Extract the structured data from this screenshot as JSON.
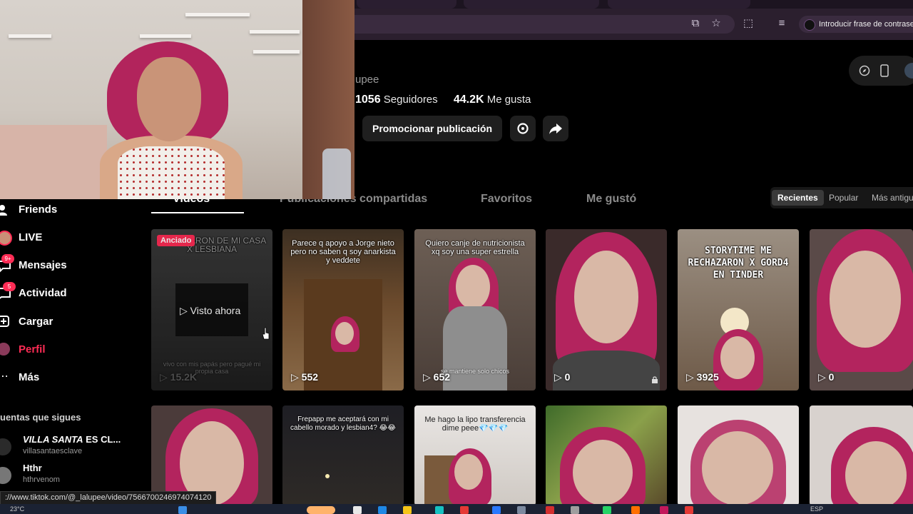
{
  "browser": {
    "toolbar_icons": [
      "install-icon",
      "star-icon",
      "extensions-icon",
      "media-icon"
    ],
    "password_chip": "Introducir frase de contrase"
  },
  "profile": {
    "handle": "upee",
    "followers_count": "1056",
    "followers_label": "Seguidores",
    "likes_count": "44.2K",
    "likes_label": "Me gusta",
    "promote_label": "Promocionar publicación"
  },
  "tabs": {
    "videos": "Videos",
    "shared": "Publicaciones compartidas",
    "favorites": "Favoritos",
    "liked": "Me gustó"
  },
  "sort": {
    "recent": "Recientes",
    "popular": "Popular",
    "oldest": "Más antigu"
  },
  "sidebar": {
    "items": [
      {
        "label": "Friends",
        "icon": "friends-icon",
        "badge": ""
      },
      {
        "label": "LIVE",
        "icon": "live-icon",
        "badge": ""
      },
      {
        "label": "Mensajes",
        "icon": "messages-icon",
        "badge": "9+"
      },
      {
        "label": "Actividad",
        "icon": "activity-icon",
        "badge": "5"
      },
      {
        "label": "Cargar",
        "icon": "upload-icon",
        "badge": ""
      },
      {
        "label": "Perfil",
        "icon": "profile-icon",
        "badge": ""
      },
      {
        "label": "Más",
        "icon": "more-icon",
        "badge": ""
      }
    ],
    "following_title": "uentas que sigues",
    "following": [
      {
        "name_a": "VILLA SANTA",
        "name_b": "ES CL...",
        "username": "villasantaesclave"
      },
      {
        "name": "Hthr",
        "username": "hthrvenom"
      }
    ]
  },
  "videos": {
    "row1": [
      {
        "caption": "ME BOTARON DE MI CASA X LESBIANA",
        "pinned_label": "Anciado",
        "watched_label": "Visto ahora",
        "sub": "vivo con mis papás pero pagué mi propia casa",
        "views": "15.2K"
      },
      {
        "caption": "Parece q apoyo a Jorge nieto pero no saben q soy anarkista y veddete",
        "views": "552"
      },
      {
        "caption": "Quiero canje de nutricionista xq soy una super estrella",
        "sub": "se mantiene solo chicos",
        "views": "652"
      },
      {
        "caption": "",
        "views": "0"
      },
      {
        "caption": "STORYTIME ME RECHAZARON X GORD4 EN TINDER",
        "views": "3925"
      },
      {
        "caption": "",
        "views": "0"
      }
    ],
    "row2": [
      {
        "caption": ""
      },
      {
        "caption": "Frepapp me aceptará con mi cabello morado y lesbian4? 😂😂"
      },
      {
        "caption": "Me hago la lipo transferencia dime peee💎💎💎"
      },
      {
        "caption": ""
      },
      {
        "caption": ""
      },
      {
        "caption": ""
      }
    ]
  },
  "status_url": "://www.tiktok.com/@_lalupee/video/7566700246974074120",
  "taskbar": {
    "temperature": "23°C",
    "language": "ESP"
  },
  "colors": {
    "accent": "#fe2c55",
    "hair": "#b3245e"
  }
}
